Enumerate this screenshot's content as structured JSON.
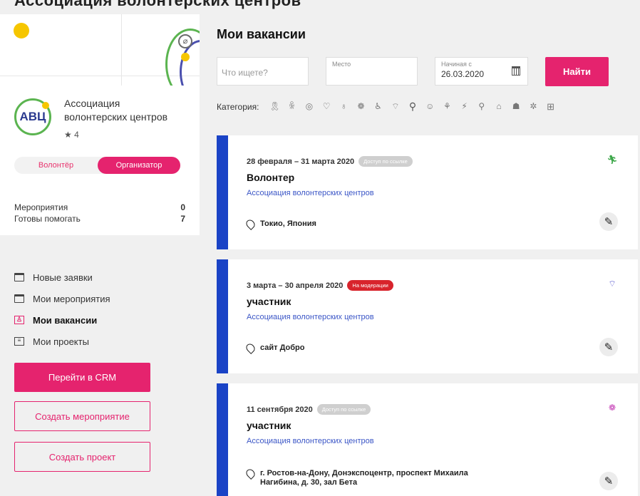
{
  "top_heading": "Ассоциация волонтерских центров",
  "profile": {
    "org_name": "Ассоциация волонтерских центров",
    "logo_text": "АВЦ",
    "rating_star": "★",
    "rating": "4",
    "role_volunteer": "Волонтёр",
    "role_organizer": "Организатор",
    "stats": [
      {
        "label": "Мероприятия",
        "value": "0"
      },
      {
        "label": "Готовы помогать",
        "value": "7"
      }
    ]
  },
  "nav": {
    "items": [
      {
        "label": "Новые заявки",
        "icon": "calendar-icon"
      },
      {
        "label": "Мои мероприятия",
        "icon": "calendar-icon"
      },
      {
        "label": "Мои вакансии",
        "icon": "vacancy-icon",
        "active": true
      },
      {
        "label": "Мои проекты",
        "icon": "document-icon"
      }
    ],
    "crm_button": "Перейти в CRM",
    "create_event_button": "Создать мероприятие",
    "create_project_button": "Создать проект"
  },
  "main": {
    "title": "Мои вакансии",
    "search": {
      "what_placeholder": "Что ищете?",
      "place_label": "Место",
      "date_label": "Начиная с",
      "date_value": "26.03.2020",
      "find_button": "Найти"
    },
    "category_label": "Категория:",
    "category_icons": [
      "ribbon-icon",
      "people-icon",
      "globe-icon",
      "heart-icon",
      "bulb-icon",
      "paw-icon",
      "wheelchair-icon",
      "graduation-icon",
      "search-icon",
      "mask-icon",
      "puzzle-icon",
      "running-icon",
      "walking-icon",
      "building-icon",
      "emergency-icon",
      "sparkle-icon",
      "grid-icon"
    ],
    "cards": [
      {
        "date": "28 февраля – 31 марта 2020",
        "badge": "Доступ по ссылке",
        "badge_color": "#cfcfcf",
        "title": "Волонтер",
        "org": "Ассоциация волонтерских центров",
        "location": "Токио, Япония",
        "category_icon": "running-icon",
        "category_color": "#3fa84b"
      },
      {
        "date": "3 марта – 30 апреля 2020",
        "badge": "На модерации",
        "badge_color": "#d8242c",
        "title": "участник",
        "org": "Ассоциация волонтерских центров",
        "location": "сайт Добро",
        "category_icon": "graduation-icon",
        "category_color": "#3a3ac6"
      },
      {
        "date": "11 сентября 2020",
        "badge": "Доступ по ссылке",
        "badge_color": "#cfcfcf",
        "title": "участник",
        "org": "Ассоциация волонтерских центров",
        "location": "г. Ростов-на-Дону, Донэкспоцентр, проспект Михаила Нагибина, д. 30, зал Бета",
        "category_icon": "paw-icon",
        "category_color": "#c43ab4"
      }
    ]
  }
}
